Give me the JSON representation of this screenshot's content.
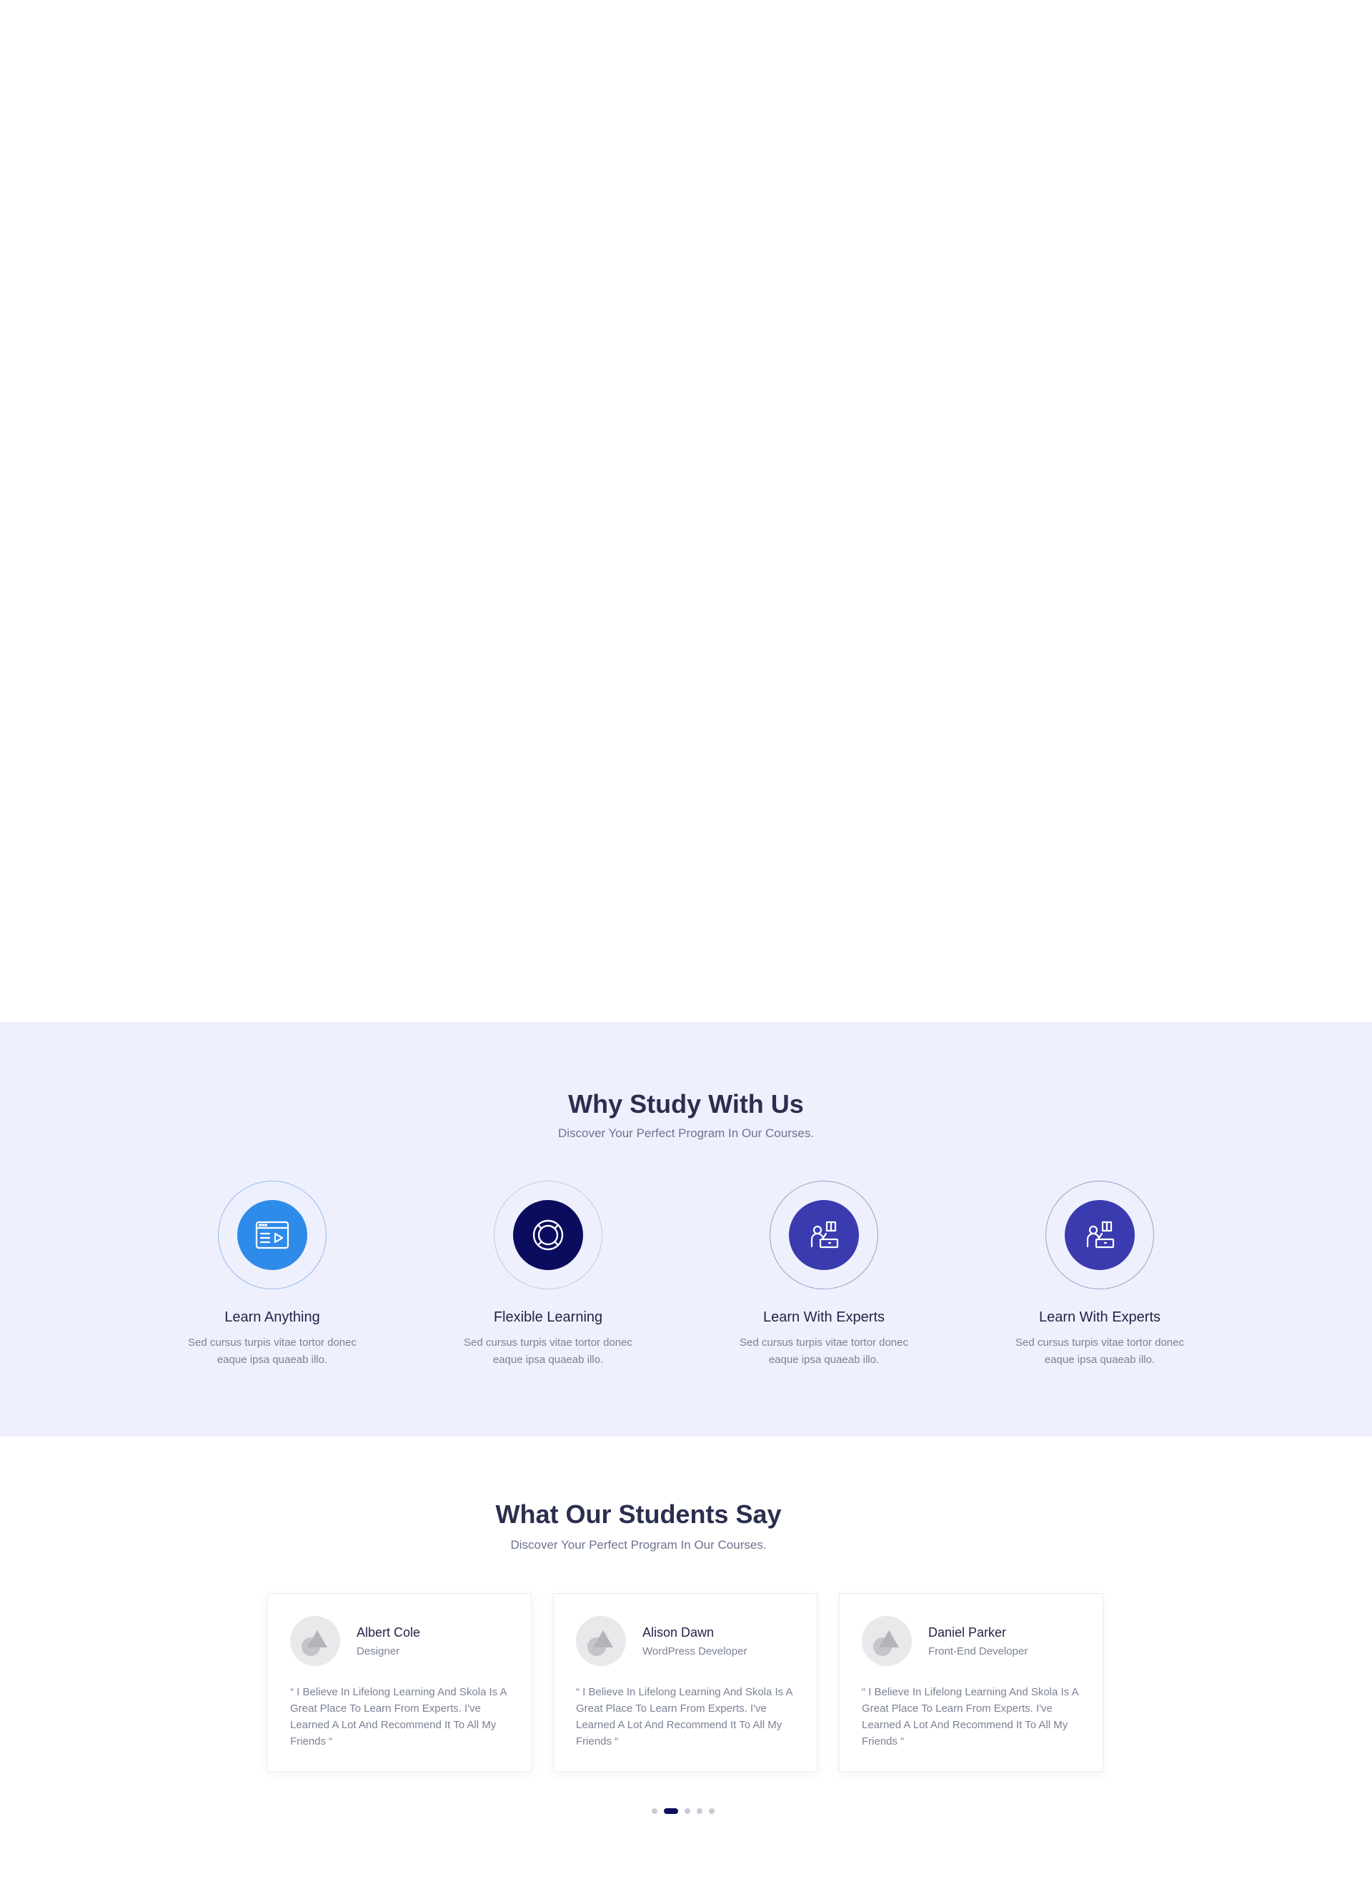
{
  "why": {
    "title": "Why Study With Us",
    "subtitle": "Discover Your Perfect Program In Our Courses.",
    "features": [
      {
        "title": "Learn Anything",
        "desc_line1": "Sed cursus turpis vitae tortor donec",
        "desc_line2": "eaque ipsa quaeab illo.",
        "icon": "online-course-icon",
        "color": "#2f8bea"
      },
      {
        "title": "Flexible Learning",
        "desc_line1": "Sed cursus turpis vitae tortor donec",
        "desc_line2": "eaque ipsa quaeab illo.",
        "icon": "lifebuoy-icon",
        "color": "#0c0c5e"
      },
      {
        "title": "Learn With Experts",
        "desc_line1": "Sed cursus turpis vitae tortor donec",
        "desc_line2": "eaque ipsa quaeab illo.",
        "icon": "teacher-icon",
        "color": "#3b3bb0"
      },
      {
        "title": "Learn With Experts",
        "desc_line1": "Sed cursus turpis vitae tortor donec",
        "desc_line2": "eaque ipsa quaeab illo.",
        "icon": "teacher-icon",
        "color": "#3b3bb0"
      }
    ]
  },
  "testimonials": {
    "title": "What Our Students Say",
    "subtitle": "Discover Your Perfect Program In Our Courses.",
    "cards": [
      {
        "name": "Albert Cole",
        "role": "Designer",
        "quote": "“ I Believe In Lifelong Learning And Skola Is A Great Place To Learn From Experts. I've Learned A Lot And Recommend It To All My Friends “"
      },
      {
        "name": "Alison Dawn",
        "role": "WordPress Developer",
        "quote": "“ I Believe In Lifelong Learning And Skola Is A Great Place To Learn From Experts. I've Learned A Lot And Recommend It To All My Friends “"
      },
      {
        "name": "Daniel Parker",
        "role": "Front-End Developer",
        "quote": "“ I Believe In Lifelong Learning And Skola Is A Great Place To Learn From Experts. I've Learned A Lot And Recommend It To All My Friends “"
      }
    ],
    "pagination": {
      "pages": 5,
      "active": 2
    }
  }
}
